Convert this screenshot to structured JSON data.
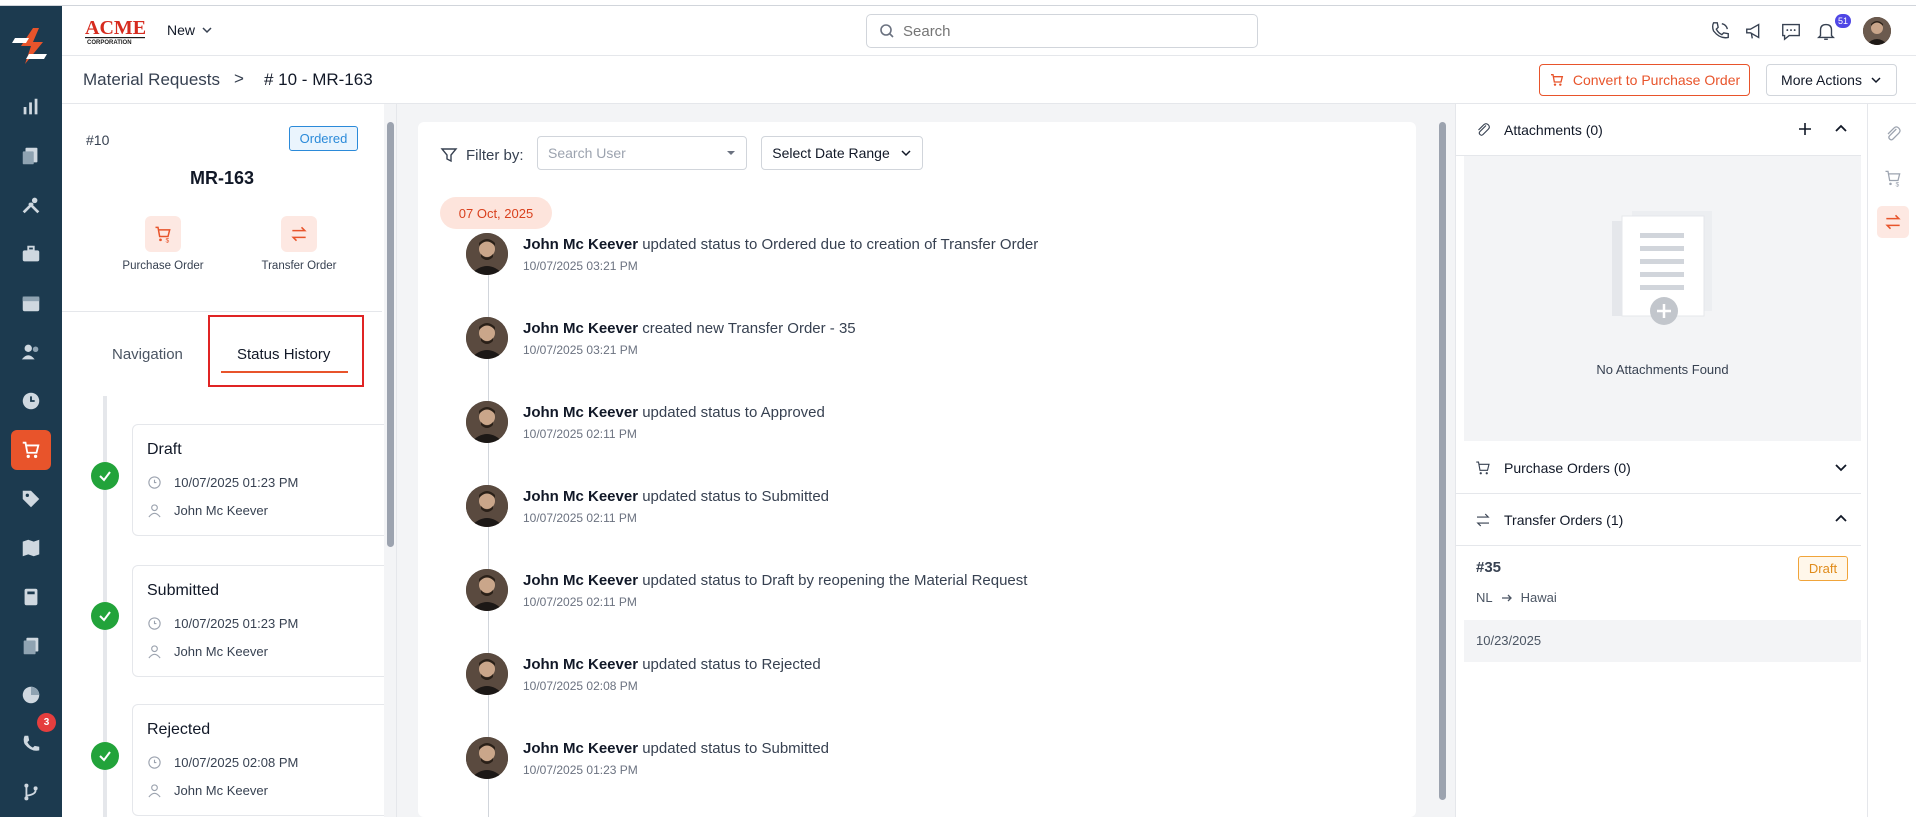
{
  "header": {
    "new_label": "New",
    "search_placeholder": "Search",
    "notification_count": "51"
  },
  "sidebar": {
    "items": [
      "reports-icon",
      "documents-icon",
      "tools-icon",
      "briefcase-icon",
      "calendar-icon",
      "users-icon",
      "clock-icon",
      "cart-icon",
      "tag-icon",
      "map-icon",
      "calculator-icon",
      "files-icon",
      "pie-chart-icon",
      "phone-icon",
      "git-icon"
    ],
    "active": "cart-icon",
    "phone_badge": "3"
  },
  "breadcrumb": {
    "parent": "Material Requests",
    "separator": ">",
    "current": "# 10 - MR-163"
  },
  "actions": {
    "convert_label": "Convert to Purchase Order",
    "more_label": "More Actions"
  },
  "request": {
    "number": "#10",
    "status": "Ordered",
    "code": "MR-163",
    "quick_actions": [
      {
        "label": "Purchase Order"
      },
      {
        "label": "Transfer Order"
      }
    ]
  },
  "tabs": {
    "navigation": "Navigation",
    "status_history": "Status History"
  },
  "status_history": [
    {
      "title": "Draft",
      "time": "10/07/2025 01:23 PM",
      "user": "John Mc Keever"
    },
    {
      "title": "Submitted",
      "time": "10/07/2025 01:23 PM",
      "user": "John Mc Keever"
    },
    {
      "title": "Rejected",
      "time": "10/07/2025 02:08 PM",
      "user": "John Mc Keever"
    }
  ],
  "filter": {
    "label": "Filter by:",
    "user_placeholder": "Search User",
    "date_range_label": "Select Date Range"
  },
  "activity": {
    "date": "07 Oct, 2025",
    "events": [
      {
        "user": "John Mc Keever",
        "text": " updated status to Ordered due to creation of Transfer Order",
        "time": "10/07/2025 03:21 PM"
      },
      {
        "user": "John Mc Keever",
        "text": " created new Transfer Order - 35",
        "time": "10/07/2025 03:21 PM"
      },
      {
        "user": "John Mc Keever",
        "text": " updated status to Approved",
        "time": "10/07/2025 02:11 PM"
      },
      {
        "user": "John Mc Keever",
        "text": " updated status to Submitted",
        "time": "10/07/2025 02:11 PM"
      },
      {
        "user": "John Mc Keever",
        "text": " updated status to Draft by reopening the Material Request",
        "time": "10/07/2025 02:11 PM"
      },
      {
        "user": "John Mc Keever",
        "text": " updated status to Rejected",
        "time": "10/07/2025 02:08 PM"
      },
      {
        "user": "John Mc Keever",
        "text": " updated status to Submitted",
        "time": "10/07/2025 01:23 PM"
      }
    ]
  },
  "right_panel": {
    "attachments_title": "Attachments (0)",
    "attachments_empty": "No Attachments Found",
    "purchase_orders_title": "Purchase Orders (0)",
    "transfer_orders_title": "Transfer Orders (1)",
    "transfer_order": {
      "number": "#35",
      "status": "Draft",
      "from": "NL",
      "to": "Hawai",
      "date": "10/23/2025"
    }
  },
  "colors": {
    "accent": "#e8542b",
    "rail": "#1c3a4f",
    "success": "#22a33a",
    "info": "#2b8ad9",
    "warning": "#e08b1a"
  }
}
